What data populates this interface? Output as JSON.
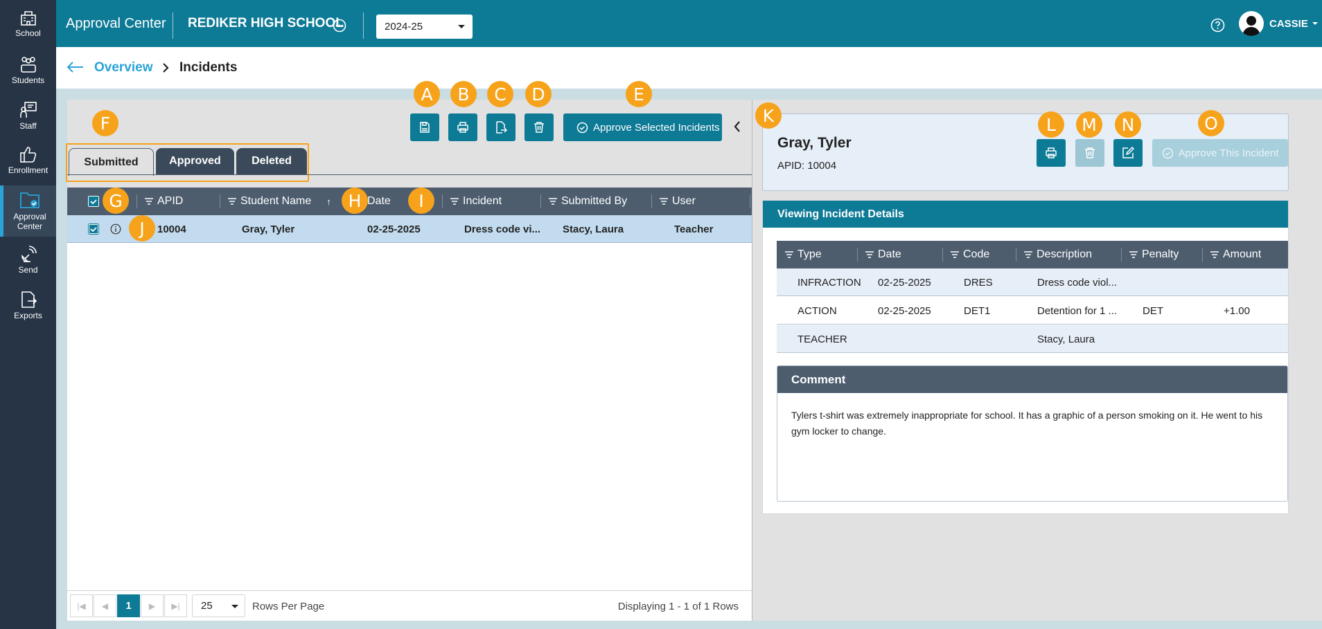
{
  "sidebar": {
    "items": [
      {
        "label": "School",
        "icon": "school-icon"
      },
      {
        "label": "Students",
        "icon": "students-icon"
      },
      {
        "label": "Staff",
        "icon": "staff-icon"
      },
      {
        "label": "Enrollment",
        "icon": "thumbs-up-icon"
      },
      {
        "label": "Approval Center",
        "icon": "folder-check-icon",
        "active": true
      },
      {
        "label": "Send",
        "icon": "satellite-icon"
      },
      {
        "label": "Exports",
        "icon": "export-icon"
      }
    ]
  },
  "topbar": {
    "app_title": "Approval Center",
    "school_name": "REDIKER HIGH SCHOOL",
    "year": "2024-25",
    "user_name": "CASSIE"
  },
  "breadcrumb": {
    "parent": "Overview",
    "current": "Incidents"
  },
  "toolbar": {
    "approve_selected_label": "Approve Selected Incidents"
  },
  "tabs": [
    {
      "label": "Submitted",
      "active": true
    },
    {
      "label": "Approved"
    },
    {
      "label": "Deleted"
    }
  ],
  "grid": {
    "columns": [
      "APID",
      "Student Name",
      "Date",
      "Incident",
      "Submitted By",
      "User"
    ],
    "sort_indicator": "↑",
    "rows": [
      {
        "apid": "10004",
        "student": "Gray, Tyler",
        "date": "02-25-2025",
        "incident": "Dress code vi...",
        "submitted_by": "Stacy, Laura",
        "user": "Teacher"
      }
    ]
  },
  "pagination": {
    "page": "1",
    "rows_per_page": "25",
    "rows_per_page_label": "Rows Per Page",
    "display_text": "Displaying 1 - 1 of 1 Rows"
  },
  "detail": {
    "name": "Gray, Tyler",
    "apid": "APID: 10004",
    "approve_label": "Approve This Incident",
    "section_title": "Viewing Incident Details",
    "columns": [
      "Type",
      "Date",
      "Code",
      "Description",
      "Penalty",
      "Amount"
    ],
    "rows": [
      {
        "type": "INFRACTION",
        "date": "02-25-2025",
        "code": "DRES",
        "description": "Dress code viol...",
        "penalty": "",
        "amount": ""
      },
      {
        "type": "ACTION",
        "date": "02-25-2025",
        "code": "DET1",
        "description": "Detention for 1 ...",
        "penalty": "DET",
        "amount": "+1.00"
      },
      {
        "type": "TEACHER",
        "date": "",
        "code": "",
        "description": "Stacy, Laura",
        "penalty": "",
        "amount": ""
      }
    ],
    "comment_title": "Comment",
    "comment": "Tylers t-shirt was extremely inappropriate for school. It has a graphic of a person smoking on it. He went to his gym locker to change."
  },
  "annotations": [
    "A",
    "B",
    "C",
    "D",
    "E",
    "F",
    "G",
    "H",
    "I",
    "J",
    "K",
    "L",
    "M",
    "N",
    "O"
  ],
  "colors": {
    "primary": "#0d7a96",
    "sidebar": "#263445",
    "header_row": "#4d5d6e",
    "badge": "#f7a21b",
    "tab_outline": "#f7a21b"
  }
}
